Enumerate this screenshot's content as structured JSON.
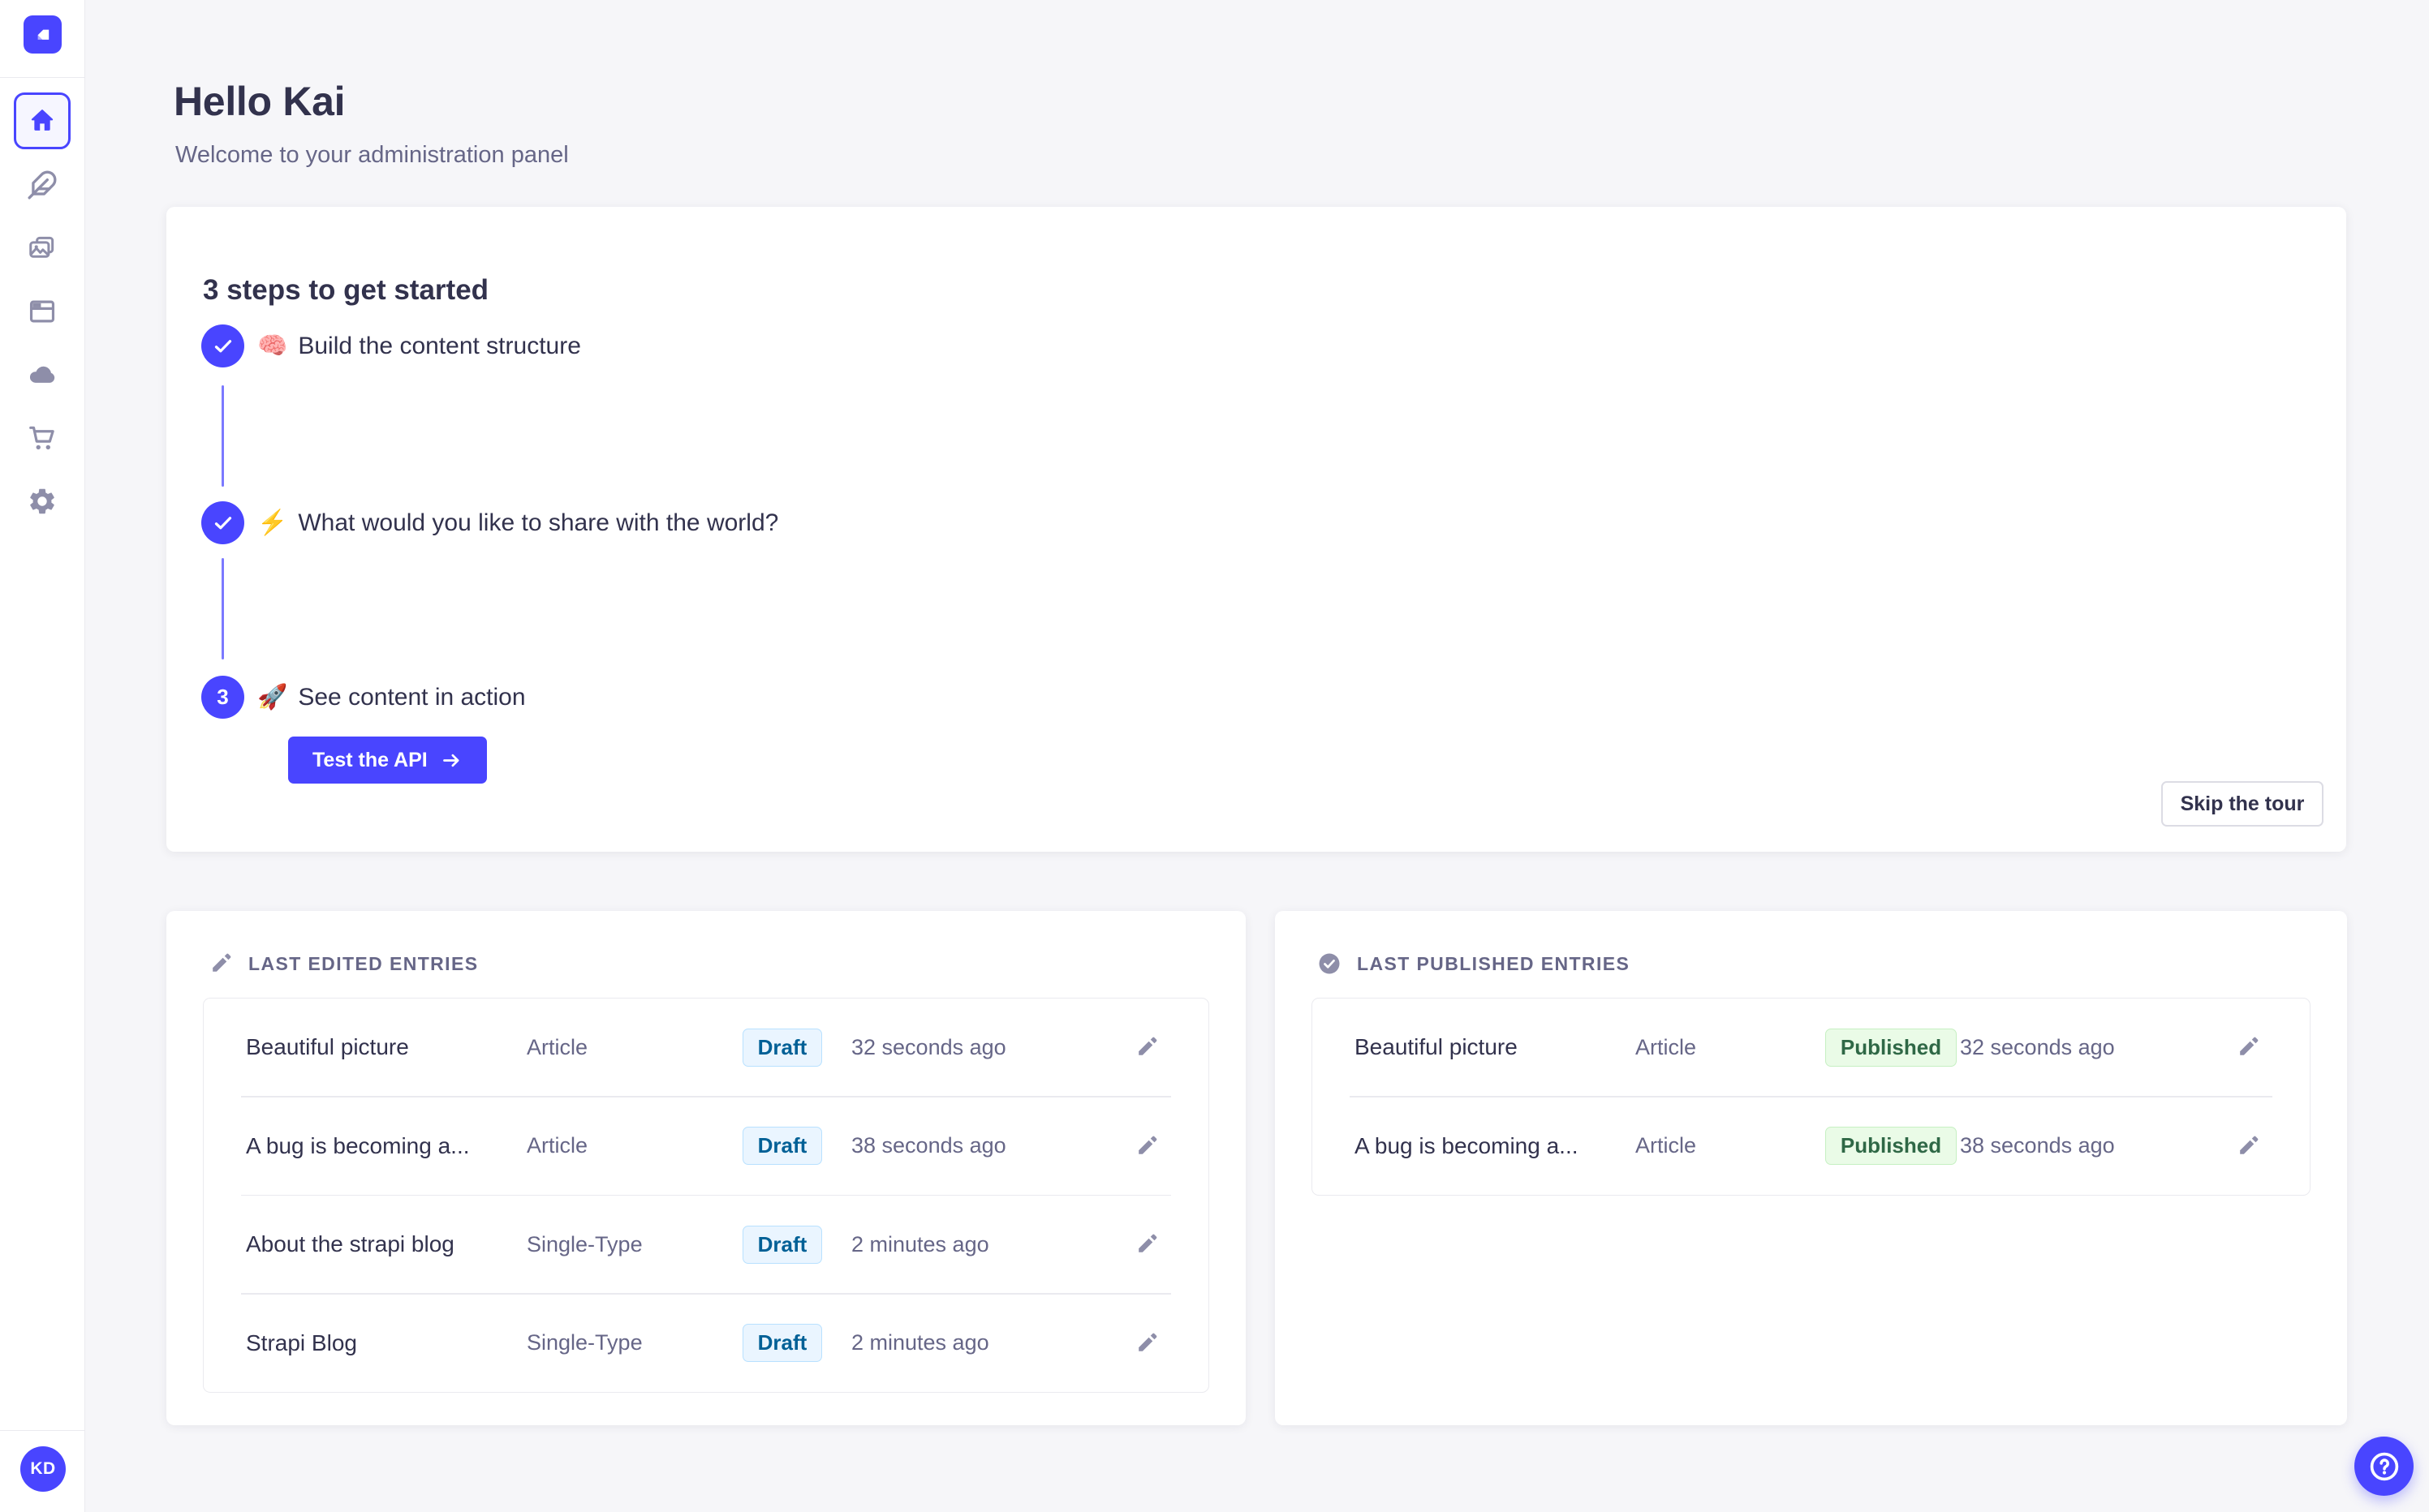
{
  "colors": {
    "accent": "#4945ff",
    "accent_light": "#7b79ff",
    "background": "#f6f6f9",
    "text_primary": "#32324d",
    "text_secondary": "#666687",
    "icon_gray": "#8e8ea9",
    "border": "#eaeaef",
    "draft_bg": "#eaf5ff",
    "draft_text": "#006096",
    "draft_border": "#b8e1ff",
    "published_bg": "#eafbe7",
    "published_text": "#2f6846",
    "published_border": "#c6f0c2"
  },
  "sidebar": {
    "avatar_initials": "KD",
    "items": [
      {
        "icon": "home-icon",
        "active": true
      },
      {
        "icon": "feather-pen-icon",
        "active": false
      },
      {
        "icon": "media-library-icon",
        "active": false
      },
      {
        "icon": "layout-builder-icon",
        "active": false
      },
      {
        "icon": "cloud-icon",
        "active": false
      },
      {
        "icon": "marketplace-cart-icon",
        "active": false
      },
      {
        "icon": "settings-gear-icon",
        "active": false
      }
    ]
  },
  "header": {
    "title": "Hello Kai",
    "subtitle": "Welcome to your administration panel"
  },
  "tour": {
    "title": "3 steps to get started",
    "steps": [
      {
        "emoji": "🧠",
        "label": "Build the content structure",
        "state": "completed"
      },
      {
        "emoji": "⚡",
        "label": "What would you like to share with the world?",
        "state": "completed"
      },
      {
        "emoji": "🚀",
        "label": "See content in action",
        "state": "current",
        "number": "3"
      }
    ],
    "cta_label": "Test the API",
    "skip_label": "Skip the tour"
  },
  "last_edited": {
    "title": "LAST EDITED ENTRIES",
    "rows": [
      {
        "title": "Beautiful picture",
        "type": "Article",
        "status": "Draft",
        "time": "32 seconds ago"
      },
      {
        "title": "A bug is becoming a...",
        "type": "Article",
        "status": "Draft",
        "time": "38 seconds ago"
      },
      {
        "title": "About the strapi blog",
        "type": "Single-Type",
        "status": "Draft",
        "time": "2 minutes ago"
      },
      {
        "title": "Strapi Blog",
        "type": "Single-Type",
        "status": "Draft",
        "time": "2 minutes ago"
      }
    ]
  },
  "last_published": {
    "title": "LAST PUBLISHED ENTRIES",
    "rows": [
      {
        "title": "Beautiful picture",
        "type": "Article",
        "status": "Published",
        "time": "32 seconds ago"
      },
      {
        "title": "A bug is becoming a...",
        "type": "Article",
        "status": "Published",
        "time": "38 seconds ago"
      }
    ]
  },
  "fab": {
    "help_glyph": "?"
  }
}
